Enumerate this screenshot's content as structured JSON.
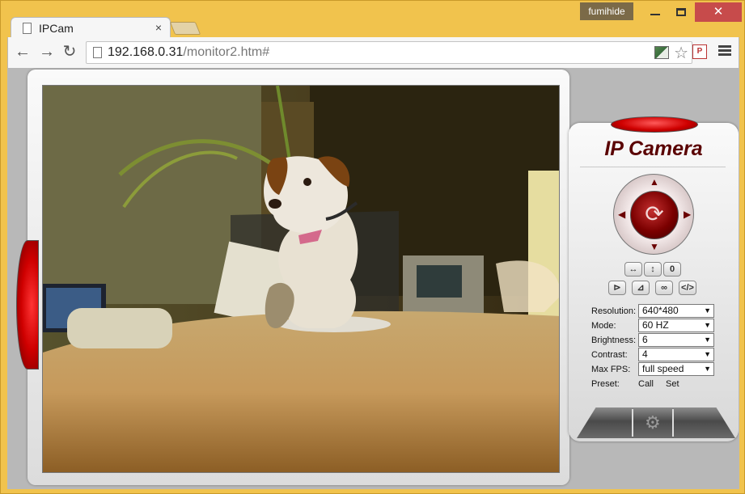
{
  "window": {
    "user": "fumihide"
  },
  "tab": {
    "title": "IPCam",
    "close_glyph": "×"
  },
  "toolbar": {
    "url_host": "192.168.0.31",
    "url_path": "/monitor2.htm#"
  },
  "panel": {
    "title": "IP Camera",
    "ptz_center_glyph": "⟳",
    "buttons": [
      {
        "label": "↔",
        "icon": "horizontal-patrol-icon"
      },
      {
        "label": "↕",
        "icon": "vertical-patrol-icon"
      },
      {
        "label": "0",
        "icon": "zero-button"
      },
      {
        "label": "⊳",
        "icon": "flip-icon"
      },
      {
        "label": "⊿",
        "icon": "mirror-icon"
      },
      {
        "label": "∞",
        "icon": "loop-icon"
      },
      {
        "label": "</>",
        "icon": "code-icon"
      }
    ],
    "settings": [
      {
        "label": "Resolution:",
        "value": "640*480"
      },
      {
        "label": "Mode:",
        "value": "60 HZ"
      },
      {
        "label": "Brightness:",
        "value": "6"
      },
      {
        "label": "Contrast:",
        "value": "4"
      },
      {
        "label": "Max FPS:",
        "value": "full speed"
      }
    ],
    "preset": {
      "label": "Preset:",
      "call": "Call",
      "set": "Set"
    }
  }
}
